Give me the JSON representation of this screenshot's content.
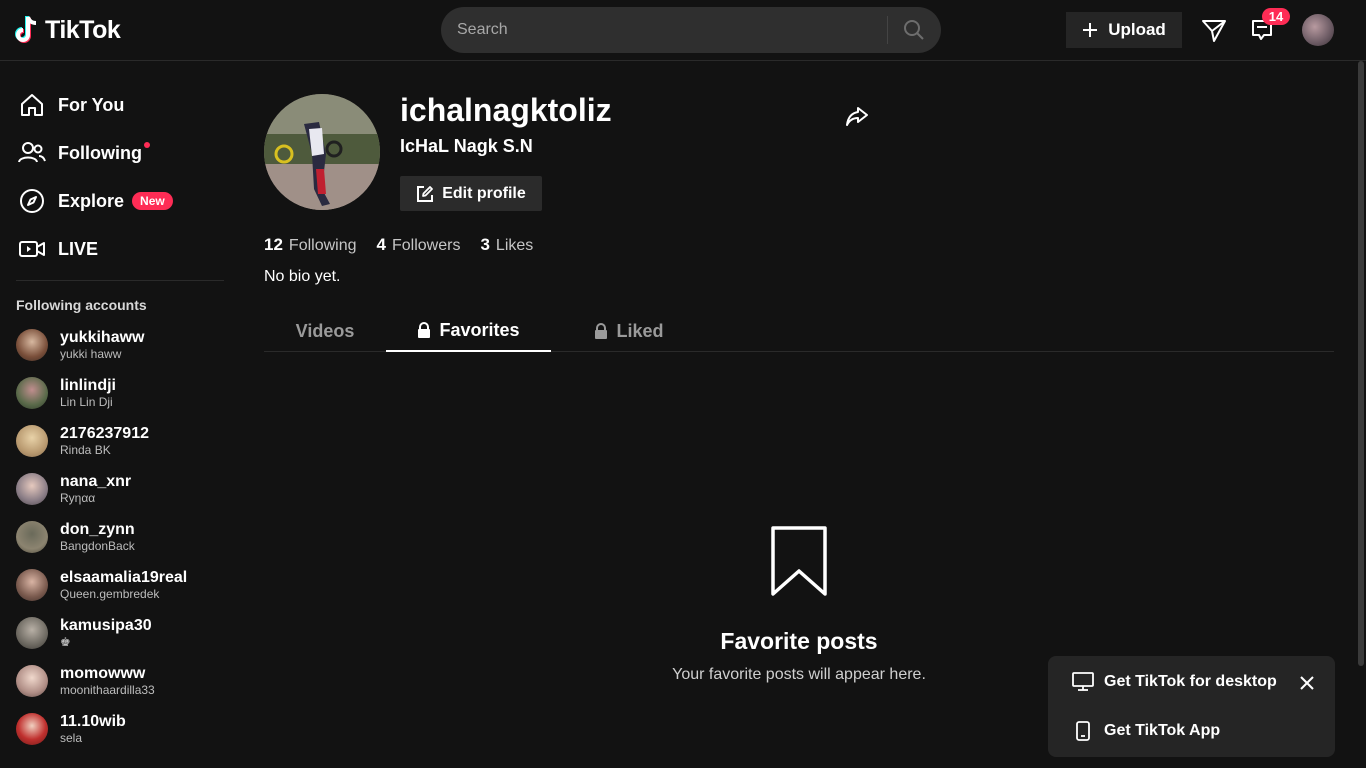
{
  "header": {
    "logo_text": "TikTok",
    "search_placeholder": "Search",
    "upload_label": "Upload",
    "inbox_count": "14"
  },
  "sidebar": {
    "nav": [
      {
        "label": "For You",
        "icon": "home-icon"
      },
      {
        "label": "Following",
        "icon": "following-icon"
      },
      {
        "label": "Explore",
        "icon": "compass-icon",
        "badge": "New"
      },
      {
        "label": "LIVE",
        "icon": "live-icon"
      }
    ],
    "following_title": "Following accounts",
    "accounts": [
      {
        "username": "yukkihaww",
        "name": "yukki haww"
      },
      {
        "username": "linlindji",
        "name": "Lin Lin Dji"
      },
      {
        "username": "2176237912",
        "name": "Rinda BK"
      },
      {
        "username": "nana_xnr",
        "name": "Ryηαα"
      },
      {
        "username": "don_zynn",
        "name": "BangdonBack"
      },
      {
        "username": "elsaamalia19real",
        "name": "Queen.gembredek"
      },
      {
        "username": "kamusipa30",
        "name": "♚"
      },
      {
        "username": "momowww",
        "name": "moonithaardilla33"
      },
      {
        "username": "11.10wib",
        "name": "sela"
      }
    ]
  },
  "profile": {
    "username": "ichalnagktoliz",
    "nickname": "IcHaL Nagk S.N",
    "edit_label": "Edit profile",
    "stats": [
      {
        "num": "12",
        "label": "Following"
      },
      {
        "num": "4",
        "label": "Followers"
      },
      {
        "num": "3",
        "label": "Likes"
      }
    ],
    "bio": "No bio yet."
  },
  "tabs": [
    {
      "label": "Videos"
    },
    {
      "label": "Favorites"
    },
    {
      "label": "Liked"
    }
  ],
  "empty": {
    "title": "Favorite posts",
    "subtitle": "Your favorite posts will appear here."
  },
  "popup": {
    "desktop_label": "Get TikTok for desktop",
    "app_label": "Get TikTok App"
  },
  "colors": {
    "accent": "#fe2c55",
    "background": "#121212"
  }
}
